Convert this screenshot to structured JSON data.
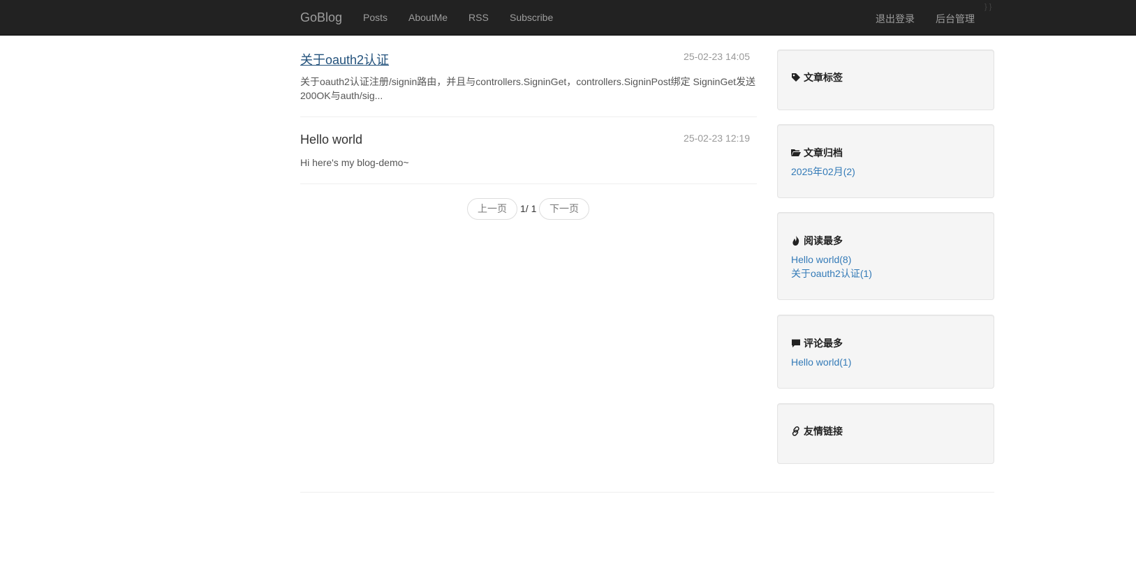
{
  "nav": {
    "brand": "GoBlog",
    "items": [
      "Posts",
      "AboutMe",
      "RSS",
      "Subscribe"
    ],
    "right": [
      "退出登录",
      "后台管理"
    ],
    "corner_glyph": "} }"
  },
  "posts": [
    {
      "title": "关于oauth2认证",
      "date": "25-02-23 14:05",
      "excerpt": "关于oauth2认证注册/signin路由，并且与controllers.SigninGet，controllers.SigninPost绑定 SigninGet发送200OK与auth/sig..."
    },
    {
      "title": "Hello world",
      "date": "25-02-23 12:19",
      "excerpt": "Hi here's my blog-demo~"
    }
  ],
  "pager": {
    "prev": "上一页",
    "page_info": "1/ 1",
    "next": "下一页"
  },
  "sidebar": {
    "tags": {
      "title": "文章标签",
      "icon": "tag-icon"
    },
    "archive": {
      "title": "文章归档",
      "icon": "folder-open-icon",
      "items": [
        "2025年02月(2)"
      ]
    },
    "most_read": {
      "title": "阅读最多",
      "icon": "fire-icon",
      "items": [
        "Hello world(8)",
        "关于oauth2认证(1)"
      ]
    },
    "most_commented": {
      "title": "评论最多",
      "icon": "comment-icon",
      "items": [
        "Hello world(1)"
      ]
    },
    "links": {
      "title": "友情链接",
      "icon": "link-icon"
    }
  },
  "colors": {
    "navbar_bg": "#222222",
    "nav_text": "#9d9d9d",
    "link": "#337ab7",
    "title_link": "#23527c",
    "widget_bg": "#f5f5f5"
  }
}
